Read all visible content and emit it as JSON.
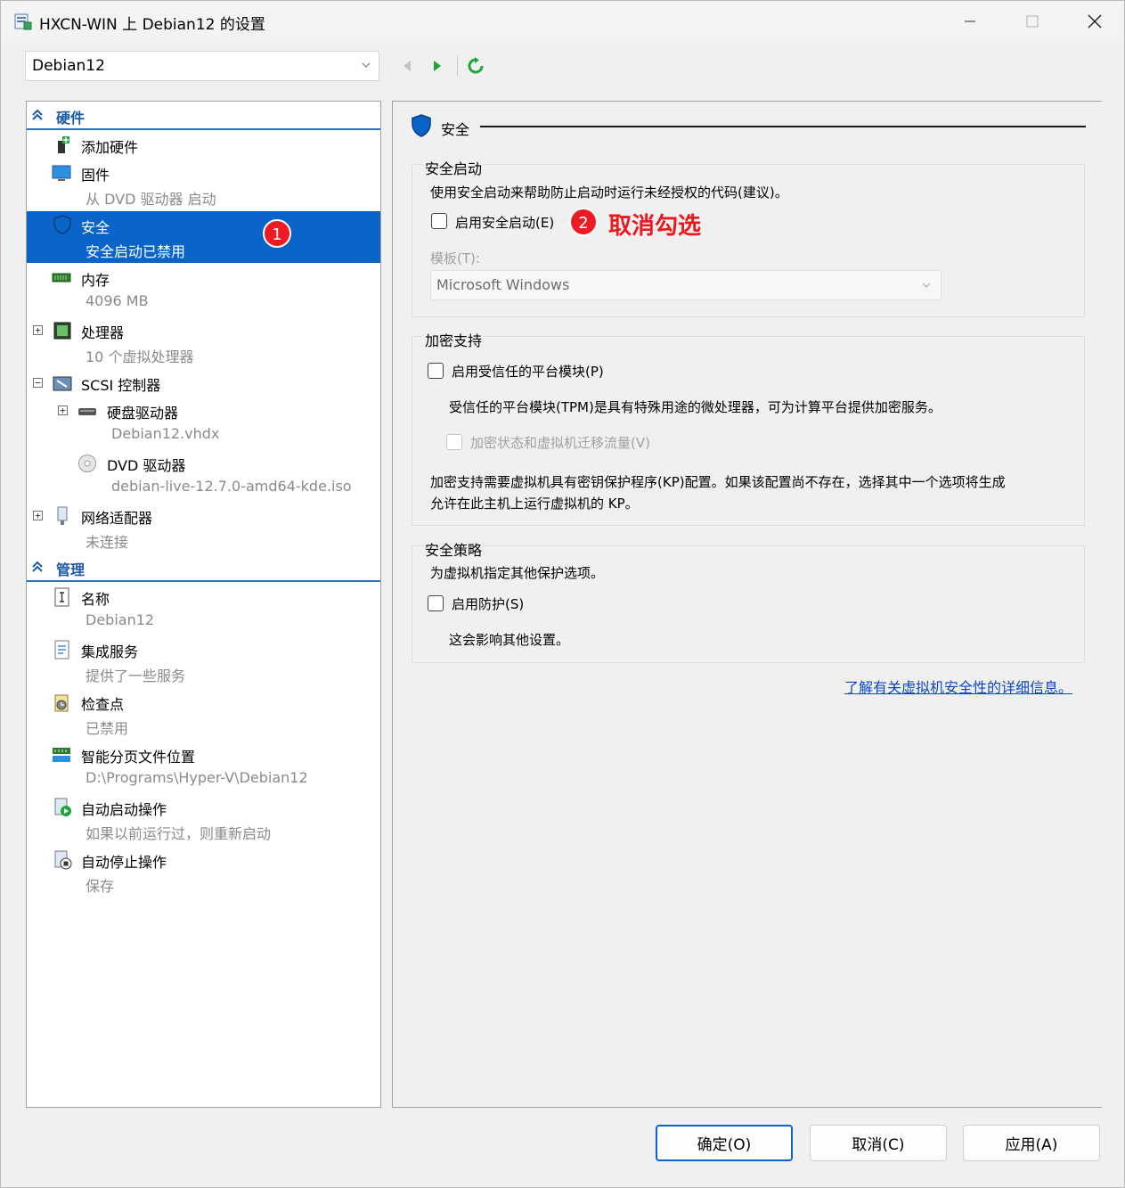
{
  "window": {
    "title": "HXCN-WIN 上 Debian12 的设置"
  },
  "vm_selector": {
    "value": "Debian12"
  },
  "left_tree": {
    "hardware_group": "硬件",
    "management_group": "管理",
    "items": [
      {
        "name": "添加硬件",
        "sub": ""
      },
      {
        "name": "固件",
        "sub": "从 DVD 驱动器 启动"
      },
      {
        "name": "安全",
        "sub": "安全启动已禁用"
      },
      {
        "name": "内存",
        "sub": "4096 MB"
      },
      {
        "name": "处理器",
        "sub": "10 个虚拟处理器"
      },
      {
        "name": "SCSI 控制器",
        "sub": ""
      },
      {
        "name": "硬盘驱动器",
        "sub": "Debian12.vhdx"
      },
      {
        "name": "DVD 驱动器",
        "sub": "debian-live-12.7.0-amd64-kde.iso"
      },
      {
        "name": "网络适配器",
        "sub": "未连接"
      },
      {
        "name": "名称",
        "sub": "Debian12"
      },
      {
        "name": "集成服务",
        "sub": "提供了一些服务"
      },
      {
        "name": "检查点",
        "sub": "已禁用"
      },
      {
        "name": "智能分页文件位置",
        "sub": "D:\\Programs\\Hyper-V\\Debian12"
      },
      {
        "name": "自动启动操作",
        "sub": "如果以前运行过，则重新启动"
      },
      {
        "name": "自动停止操作",
        "sub": "保存"
      }
    ]
  },
  "badges": {
    "one": "1",
    "two": "2"
  },
  "security": {
    "header": "安全",
    "secure_boot": {
      "title": "安全启动",
      "desc": "使用安全启动来帮助防止启动时运行未经授权的代码(建议)。",
      "enable_label": "启用安全启动(E)",
      "enable_checked": false,
      "template_label": "模板(T):",
      "template_value": "Microsoft Windows"
    },
    "encryption": {
      "title": "加密支持",
      "tpm_label": "启用受信任的平台模块(P)",
      "tpm_desc": "受信任的平台模块(TPM)是具有特殊用途的微处理器，可为计算平台提供加密服务。",
      "encrypt_label": "加密状态和虚拟机迁移流量(V)",
      "kp_note_line1": "加密支持需要虚拟机具有密钥保护程序(KP)配置。如果该配置尚不存在，选择其中一个选项将生成",
      "kp_note_line2": "允许在此主机上运行虚拟机的 KP。"
    },
    "policy": {
      "title": "安全策略",
      "desc": "为虚拟机指定其他保护选项。",
      "shield_label": "启用防护(S)",
      "shield_note": "这会影响其他设置。"
    },
    "learn_more": "了解有关虚拟机安全性的详细信息。"
  },
  "annotation": "取消勾选",
  "buttons": {
    "ok": "确定(O)",
    "cancel": "取消(C)",
    "apply": "应用(A)"
  },
  "colors": {
    "selection": "#0a64c8",
    "annotation": "#e8191f",
    "group_header": "#1a5aa8",
    "link": "#0b46c8"
  }
}
